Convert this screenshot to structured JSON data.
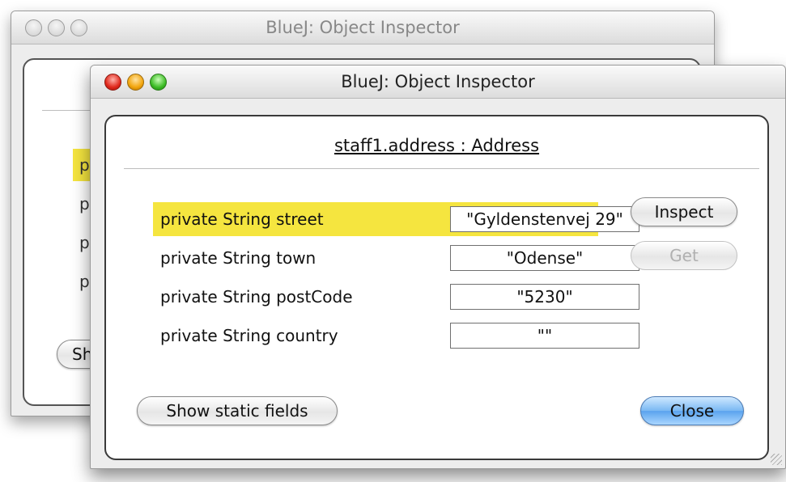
{
  "back_window": {
    "title": "BlueJ:  Object Inspector",
    "field_stubs": [
      "p",
      "p",
      "p",
      "p"
    ],
    "static_button_stub": "Sh"
  },
  "front_window": {
    "title": "BlueJ:  Object Inspector",
    "object_title": "staff1.address : Address",
    "fields": [
      {
        "label": "private String street",
        "value": "\"Gyldenstenvej 29\"",
        "selected": true
      },
      {
        "label": "private String town",
        "value": "\"Odense\"",
        "selected": false
      },
      {
        "label": "private String postCode",
        "value": "\"5230\"",
        "selected": false
      },
      {
        "label": "private String country",
        "value": "\"\"",
        "selected": false
      }
    ],
    "buttons": {
      "inspect": "Inspect",
      "get": "Get",
      "show_static": "Show static fields",
      "close": "Close"
    }
  },
  "colors": {
    "selection_highlight": "#f5e53f",
    "close_button_blue": "#5aa3ee"
  }
}
